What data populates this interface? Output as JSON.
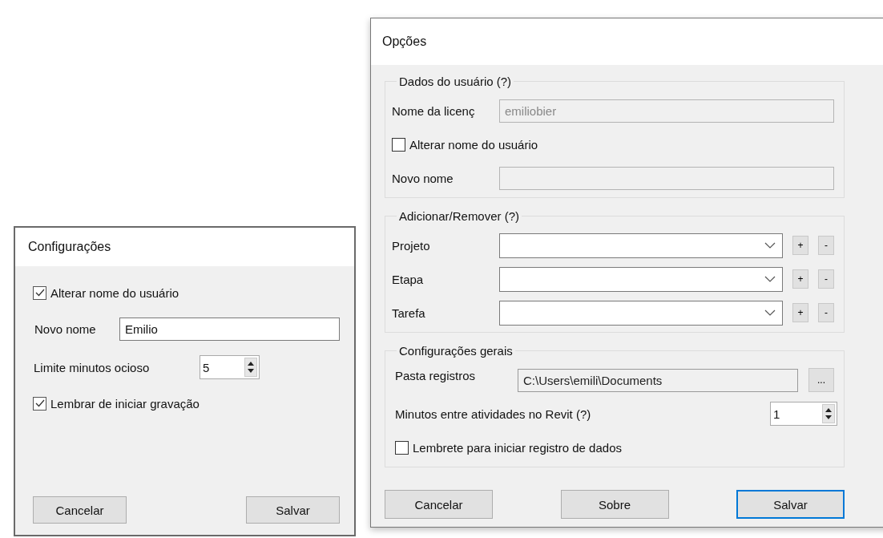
{
  "config_dialog": {
    "title": "Configurações",
    "rows": [
      {
        "kind": "checkbox",
        "label": "Alterar nome do usuário",
        "checked": true
      },
      {
        "kind": "text",
        "label": "Novo nome",
        "value": "Emilio",
        "disabled": false
      },
      {
        "kind": "spinner",
        "label": "Limite minutos ocioso",
        "value": "5"
      },
      {
        "kind": "checkbox",
        "label": "Lembrar de iniciar gravação",
        "checked": true
      }
    ],
    "buttons": [
      {
        "label": "Cancelar",
        "focused": false
      },
      {
        "label": "Salvar",
        "focused": false
      }
    ]
  },
  "options_dialog": {
    "title": "Opções",
    "groups": [
      {
        "title": "Dados do usuário (?)",
        "rows": [
          {
            "kind": "text",
            "label": "Nome da licenç",
            "value": "emiliobier",
            "disabled": true
          },
          {
            "kind": "checkbox",
            "label": "Alterar nome do usuário",
            "checked": false
          },
          {
            "kind": "text",
            "label": "Novo nome",
            "disabled": true
          }
        ]
      },
      {
        "title": "Adicionar/Remover (?)",
        "rows": [
          {
            "kind": "combo",
            "label": "Projeto",
            "add": "+",
            "remove": "-"
          },
          {
            "kind": "combo",
            "label": "Etapa",
            "add": "+",
            "remove": "-"
          },
          {
            "kind": "combo",
            "label": "Tarefa",
            "add": "+",
            "remove": "-"
          }
        ]
      },
      {
        "title": "Configurações gerais",
        "rows": [
          {
            "kind": "path",
            "label": "Pasta registros",
            "value": "C:\\Users\\emili\\Documents",
            "browse": "..."
          },
          {
            "kind": "spinner",
            "label": "Minutos entre atividades no Revit (?)",
            "value": "1"
          },
          {
            "kind": "checkbox",
            "label": "Lembrete para iniciar registro de dados",
            "checked": false
          }
        ]
      }
    ],
    "buttons": [
      {
        "label": "Cancelar",
        "focused": false
      },
      {
        "label": "Sobre",
        "focused": false
      },
      {
        "label": "Salvar",
        "focused": true
      }
    ]
  }
}
